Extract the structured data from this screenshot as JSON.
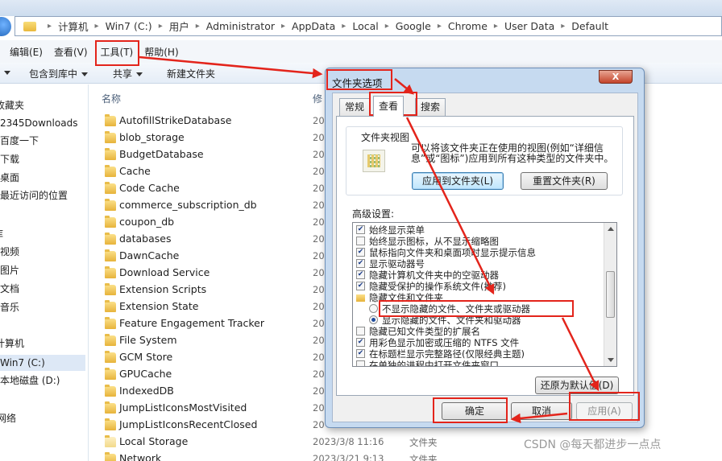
{
  "explorer": {
    "breadcrumbs": [
      "计算机",
      "Win7 (C:)",
      "用户",
      "Administrator",
      "AppData",
      "Local",
      "Google",
      "Chrome",
      "User Data",
      "Default"
    ],
    "menu": {
      "edit": "编辑(E)",
      "view": "查看(V)",
      "tools": "工具(T)",
      "help": "帮助(H)"
    },
    "toolbar": {
      "include": "包含到库中",
      "share": "共享",
      "new_folder": "新建文件夹"
    },
    "nav": [
      "收藏夹",
      "2345Downloads",
      "百度一下",
      "下载",
      "桌面",
      "最近访问的位置",
      "库",
      "视频",
      "图片",
      "文档",
      "音乐",
      "计算机",
      "Win7 (C:)",
      "本地磁盘 (D:)",
      "网络"
    ],
    "columns": {
      "name": "名称",
      "date": "修"
    },
    "files": [
      {
        "name": "AutofillStrikeDatabase",
        "date": "20",
        "type": ""
      },
      {
        "name": "blob_storage",
        "date": "20",
        "type": ""
      },
      {
        "name": "BudgetDatabase",
        "date": "20",
        "type": ""
      },
      {
        "name": "Cache",
        "date": "20",
        "type": ""
      },
      {
        "name": "Code Cache",
        "date": "20",
        "type": ""
      },
      {
        "name": "commerce_subscription_db",
        "date": "20",
        "type": ""
      },
      {
        "name": "coupon_db",
        "date": "20",
        "type": ""
      },
      {
        "name": "databases",
        "date": "20",
        "type": ""
      },
      {
        "name": "DawnCache",
        "date": "20",
        "type": ""
      },
      {
        "name": "Download Service",
        "date": "20",
        "type": ""
      },
      {
        "name": "Extension Scripts",
        "date": "20",
        "type": ""
      },
      {
        "name": "Extension State",
        "date": "20",
        "type": ""
      },
      {
        "name": "Feature Engagement Tracker",
        "date": "20",
        "type": ""
      },
      {
        "name": "File System",
        "date": "20",
        "type": ""
      },
      {
        "name": "GCM Store",
        "date": "20",
        "type": ""
      },
      {
        "name": "GPUCache",
        "date": "20",
        "type": ""
      },
      {
        "name": "IndexedDB",
        "date": "20",
        "type": ""
      },
      {
        "name": "JumpListIconsMostVisited",
        "date": "20",
        "type": ""
      },
      {
        "name": "JumpListIconsRecentClosed",
        "date": "20",
        "type": ""
      },
      {
        "name": "Local Storage",
        "date": "2023/3/8 11:16",
        "type": "文件夹"
      },
      {
        "name": "Network",
        "date": "2023/3/21 9:13",
        "type": "文件夹"
      }
    ]
  },
  "dialog": {
    "title": "文件夹选项",
    "close": "X",
    "tabs": [
      "常规",
      "查看",
      "搜索"
    ],
    "folder_views": {
      "label": "文件夹视图",
      "description": "可以将该文件夹正在使用的视图(例如“详细信息”或“图标”)应用到所有这种类型的文件夹中。",
      "apply_button": "应用到文件夹(L)",
      "reset_button": "重置文件夹(R)"
    },
    "advanced_label": "高级设置:",
    "settings": [
      {
        "kind": "checkbox",
        "checked": true,
        "label": "始终显示菜单"
      },
      {
        "kind": "checkbox",
        "checked": false,
        "label": "始终显示图标，从不显示缩略图"
      },
      {
        "kind": "checkbox",
        "checked": true,
        "label": "鼠标指向文件夹和桌面项时显示提示信息"
      },
      {
        "kind": "checkbox",
        "checked": true,
        "label": "显示驱动器号"
      },
      {
        "kind": "checkbox",
        "checked": true,
        "label": "隐藏计算机文件夹中的空驱动器"
      },
      {
        "kind": "checkbox",
        "checked": true,
        "label": "隐藏受保护的操作系统文件(推荐)"
      },
      {
        "kind": "folder",
        "checked": false,
        "label": "隐藏文件和文件夹"
      },
      {
        "kind": "radio",
        "checked": false,
        "label": "不显示隐藏的文件、文件夹或驱动器"
      },
      {
        "kind": "radio",
        "checked": true,
        "label": "显示隐藏的文件、文件夹和驱动器"
      },
      {
        "kind": "checkbox",
        "checked": false,
        "label": "隐藏已知文件类型的扩展名"
      },
      {
        "kind": "checkbox",
        "checked": true,
        "label": "用彩色显示加密或压缩的 NTFS 文件"
      },
      {
        "kind": "checkbox",
        "checked": true,
        "label": "在标题栏显示完整路径(仅限经典主题)"
      },
      {
        "kind": "checkbox",
        "checked": false,
        "label": "在单独的进程中打开文件夹窗口"
      }
    ],
    "restore_button": "还原为默认值(D)",
    "ok_button": "确定",
    "cancel_button": "取消",
    "apply_button": "应用(A)"
  },
  "colors": {
    "annotation": "#e3241b",
    "accent": "#3c7fb1"
  },
  "watermark": "CSDN @每天都进步一点点"
}
